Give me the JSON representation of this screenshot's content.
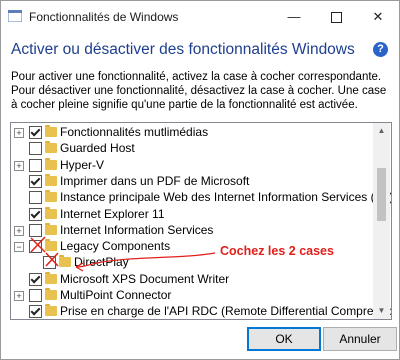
{
  "window": {
    "title": "Fonctionnalités de Windows",
    "minimize": "—",
    "close": "✕"
  },
  "heading": "Activer ou désactiver des fonctionnalités Windows",
  "help": "?",
  "description": "Pour activer une fonctionnalité, activez la case à cocher correspondante. Pour désactiver une fonctionnalité, désactivez la case à cocher. Une case à cocher pleine signifie qu'une partie de la fonctionnalité est activée.",
  "features": [
    {
      "label": "Fonctionnalités mutlimédias",
      "expandable": true,
      "checked": true,
      "indent": 0
    },
    {
      "label": "Guarded Host",
      "expandable": false,
      "checked": false,
      "indent": 0
    },
    {
      "label": "Hyper-V",
      "expandable": true,
      "checked": false,
      "indent": 0
    },
    {
      "label": "Imprimer dans un PDF de Microsoft",
      "expandable": false,
      "checked": true,
      "indent": 0
    },
    {
      "label": "Instance principale Web des Internet Information Services (IIS)",
      "expandable": false,
      "checked": false,
      "indent": 0
    },
    {
      "label": "Internet Explorer 11",
      "expandable": false,
      "checked": true,
      "indent": 0
    },
    {
      "label": "Internet Information Services",
      "expandable": true,
      "checked": false,
      "indent": 0
    },
    {
      "label": "Legacy Components",
      "expandable": true,
      "expanded": true,
      "checked": false,
      "indent": 0
    },
    {
      "label": "DirectPlay",
      "expandable": false,
      "checked": false,
      "indent": 1
    },
    {
      "label": "Microsoft XPS Document Writer",
      "expandable": false,
      "checked": true,
      "indent": 0
    },
    {
      "label": "MultiPoint Connector",
      "expandable": true,
      "checked": false,
      "indent": 0
    },
    {
      "label": "Prise en charge de l'API RDC (Remote Differential Compression)",
      "expandable": false,
      "checked": true,
      "indent": 0
    }
  ],
  "annotation": "Cochez les  2 cases",
  "buttons": {
    "ok": "OK",
    "cancel": "Annuler"
  },
  "colors": {
    "heading": "#1e3f8f",
    "annotation": "#e0201a",
    "help": "#2a63c9",
    "folder": "#e8c14f"
  }
}
